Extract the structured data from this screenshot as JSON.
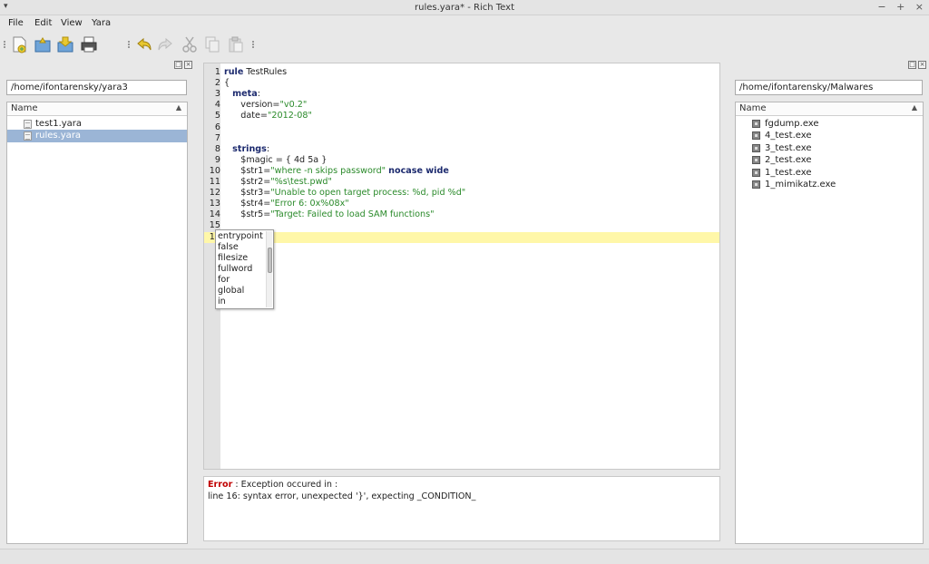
{
  "window": {
    "title": "rules.yara* - Rich Text",
    "menu_glyph": "▾",
    "controls": [
      "−",
      "+",
      "×"
    ]
  },
  "menubar": {
    "file": "File",
    "edit": "Edit",
    "view": "View",
    "yara": "Yara"
  },
  "toolbar": {
    "items": [
      "new-file-icon",
      "open-file-icon",
      "save-file-icon",
      "print-icon",
      "undo-icon",
      "redo-icon",
      "cut-icon",
      "copy-icon",
      "paste-icon"
    ]
  },
  "left_panel": {
    "path": "/home/ifontarensky/yara3",
    "column": "Name",
    "files": [
      {
        "name": "test1.yara",
        "selected": false
      },
      {
        "name": "rules.yara",
        "selected": true
      }
    ]
  },
  "right_panel": {
    "path": "/home/ifontarensky/Malwares",
    "column": "Name",
    "files": [
      {
        "name": "fgdump.exe"
      },
      {
        "name": "4_test.exe"
      },
      {
        "name": "3_test.exe"
      },
      {
        "name": "2_test.exe"
      },
      {
        "name": "1_test.exe"
      },
      {
        "name": "1_mimikatz.exe"
      }
    ]
  },
  "editor": {
    "lines": [
      {
        "n": "1",
        "parts": [
          {
            "t": "rule",
            "c": "kw"
          },
          {
            "t": " TestRules",
            "c": ""
          }
        ]
      },
      {
        "n": "2",
        "parts": [
          {
            "t": "{",
            "c": ""
          }
        ]
      },
      {
        "n": "3",
        "parts": [
          {
            "t": "   ",
            "c": ""
          },
          {
            "t": "meta",
            "c": "kw"
          },
          {
            "t": ":",
            "c": ""
          }
        ]
      },
      {
        "n": "4",
        "parts": [
          {
            "t": "      version=",
            "c": ""
          },
          {
            "t": "\"v0.2\"",
            "c": "str"
          }
        ]
      },
      {
        "n": "5",
        "parts": [
          {
            "t": "      date=",
            "c": ""
          },
          {
            "t": "\"2012-08\"",
            "c": "str"
          }
        ]
      },
      {
        "n": "6",
        "parts": []
      },
      {
        "n": "7",
        "parts": []
      },
      {
        "n": "8",
        "parts": [
          {
            "t": "   ",
            "c": ""
          },
          {
            "t": "strings",
            "c": "kw"
          },
          {
            "t": ":",
            "c": ""
          }
        ]
      },
      {
        "n": "9",
        "parts": [
          {
            "t": "      $magic = { 4d 5a }",
            "c": ""
          }
        ]
      },
      {
        "n": "10",
        "parts": [
          {
            "t": "      $str1=",
            "c": ""
          },
          {
            "t": "\"where -n skips password\"",
            "c": "str"
          },
          {
            "t": " ",
            "c": ""
          },
          {
            "t": "nocase wide",
            "c": "kw"
          }
        ]
      },
      {
        "n": "11",
        "parts": [
          {
            "t": "      $str2=",
            "c": ""
          },
          {
            "t": "\"%s\\test.pwd\"",
            "c": "str"
          }
        ]
      },
      {
        "n": "12",
        "parts": [
          {
            "t": "      $str3=",
            "c": ""
          },
          {
            "t": "\"Unable to open target process: %d, pid %d\"",
            "c": "str"
          }
        ]
      },
      {
        "n": "13",
        "parts": [
          {
            "t": "      $str4=",
            "c": ""
          },
          {
            "t": "\"Error 6: 0x%08x\"",
            "c": "str"
          }
        ]
      },
      {
        "n": "14",
        "parts": [
          {
            "t": "      $str5=",
            "c": ""
          },
          {
            "t": "\"Target: Failed to load SAM functions\"",
            "c": "str"
          }
        ]
      },
      {
        "n": "15",
        "parts": []
      },
      {
        "n": "16",
        "parts": [],
        "current": true
      },
      {
        "n": "1",
        "parts": []
      }
    ],
    "visible_line_numbers": [
      "1",
      "2",
      "3",
      "4",
      "5",
      "6",
      "7",
      "8",
      "9",
      "10",
      "11",
      "12",
      "13",
      "14",
      "15",
      "1"
    ]
  },
  "autocomplete": {
    "items": [
      "entrypoint",
      "false",
      "filesize",
      "fullword",
      "for",
      "global",
      "in"
    ]
  },
  "errors": {
    "label": "Error",
    "header_rest": " : Exception occured in :",
    "detail": "line 16: syntax error, unexpected '}', expecting _CONDITION_"
  }
}
